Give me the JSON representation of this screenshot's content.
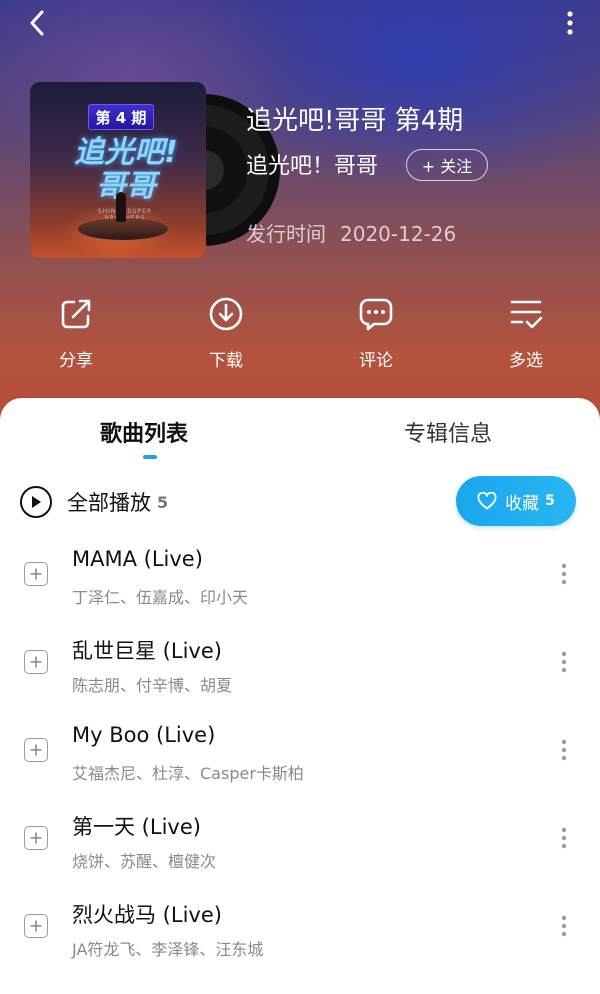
{
  "header": {
    "album_title": "追光吧!哥哥 第4期",
    "artist": "追光吧！哥哥",
    "follow_label": "+ 关注",
    "release_label": "发行时间",
    "release_date": "2020-12-26"
  },
  "cover": {
    "episode_badge": "第 4 期",
    "title_line1": "追光吧!",
    "title_line2": "哥哥",
    "subtitle": "SHINE! SUPER BROTHERS"
  },
  "actions": [
    {
      "label": "分享",
      "icon": "share-icon"
    },
    {
      "label": "下载",
      "icon": "download-icon"
    },
    {
      "label": "评论",
      "icon": "comment-icon"
    },
    {
      "label": "多选",
      "icon": "multi-select-icon"
    }
  ],
  "tabs": {
    "songs": "歌曲列表",
    "info": "专辑信息"
  },
  "play_all": {
    "label": "全部播放",
    "count": "5"
  },
  "collect": {
    "label": "收藏",
    "count": "5"
  },
  "songs": [
    {
      "title": "MAMA (Live)",
      "artists": "丁泽仁、伍嘉成、印小天"
    },
    {
      "title": "乱世巨星 (Live)",
      "artists": "陈志朋、付辛博、胡夏"
    },
    {
      "title": "My Boo (Live)",
      "artists": "艾福杰尼、杜淳、Casper卡斯柏"
    },
    {
      "title": "第一天 (Live)",
      "artists": "烧饼、苏醒、檀健次"
    },
    {
      "title": "烈火战马 (Live)",
      "artists": "JA符龙飞、李泽锋、汪东城"
    }
  ],
  "colors": {
    "accent": "#1fa3e6",
    "header_top": "#3c3a8c",
    "header_bottom": "#b64c36"
  }
}
